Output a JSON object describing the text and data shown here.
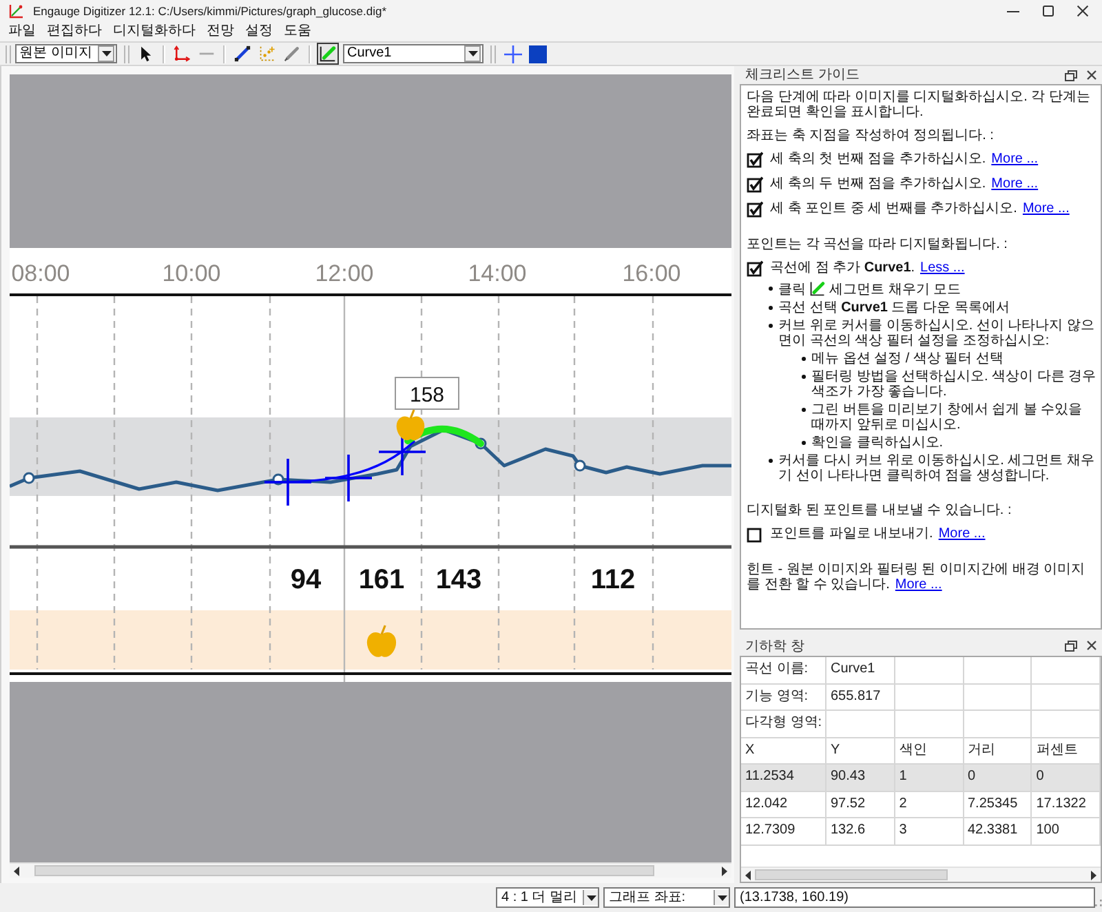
{
  "window": {
    "title": "Engauge Digitizer 12.1: C:/Users/kimmi/Pictures/graph_glucose.dig*"
  },
  "menu": [
    "파일",
    "편집하다",
    "디지털화하다",
    "전망",
    "설정",
    "도움"
  ],
  "toolbar": {
    "background": "원본 이미지",
    "tools": [
      {
        "kind": "pointer",
        "selected": false
      },
      {
        "kind": "axis",
        "selected": false
      },
      {
        "kind": "scale",
        "selected": false
      },
      {
        "kind": "curve",
        "selected": false
      },
      {
        "kind": "match",
        "selected": false
      },
      {
        "kind": "color",
        "selected": false
      },
      {
        "kind": "segment",
        "selected": true
      }
    ],
    "curve": "Curve1",
    "view_tools": [
      {
        "kind": "crosshair"
      },
      {
        "kind": "square"
      }
    ]
  },
  "graph": {
    "x_labels": [
      "08:00",
      "10:00",
      "12:00",
      "14:00",
      "16:00"
    ],
    "tooltip": "158",
    "readings": [
      "94",
      "161",
      "143",
      "112"
    ]
  },
  "checklist": {
    "title": "체크리스트 가이드",
    "blocks": [
      {
        "kind": "paragraph",
        "text": "다음 단계에 따라 이미지를 디지털화하십시오. 각 단계는 완료되면 확인을 표시합니다."
      },
      {
        "kind": "paragraph",
        "text": "좌표는 축 지점을 작성하여 정의됩니다. :"
      },
      {
        "kind": "step",
        "checked": true,
        "text": "세 축의 첫 번째 점을 추가하십시오.",
        "link": "More ..."
      },
      {
        "kind": "step",
        "checked": true,
        "text": "세 축의 두 번째 점을 추가하십시오.",
        "link": "More ..."
      },
      {
        "kind": "step",
        "checked": true,
        "text": "세 축 포인트 중 세 번째를 추가하십시오.",
        "link": "More ..."
      },
      {
        "kind": "paragraph",
        "text": "포인트는 각 곡선을 따라 디지털화됩니다. :"
      },
      {
        "kind": "step",
        "checked": true,
        "text": "곡선에 점 추가 **Curve1**.",
        "link": "Less ...",
        "bullets": [
          {
            "kind": "icon_text",
            "text": "클릭",
            "text_after": "세그먼트 채우기 모드"
          },
          {
            "kind": "text",
            "text": "곡선 선택 **Curve1** 드롭 다운 목록에서"
          },
          {
            "kind": "text",
            "text": "커브 위로 커서를 이동하십시오. 선이 나타나지 않으면이 곡선의 색상 필터 설정을 조정하십시오:",
            "children": [
              {
                "kind": "text",
                "text": "메뉴 옵션 설정 / 색상 필터 선택"
              },
              {
                "kind": "text",
                "text": "필터링 방법을 선택하십시오. 색상이 다른 경우 색조가 가장 좋습니다."
              },
              {
                "kind": "text",
                "text": "그린 버튼을 미리보기 창에서 쉽게 볼 수있을 때까지 앞뒤로 미십시오."
              },
              {
                "kind": "text",
                "text": "확인을 클릭하십시오."
              }
            ]
          },
          {
            "kind": "text",
            "text": "커서를 다시 커브 위로 이동하십시오. 세그먼트 채우기 선이 나타나면 클릭하여 점을 생성합니다."
          }
        ]
      },
      {
        "kind": "paragraph",
        "text": "디지털화 된 포인트를 내보낼 수 있습니다. :"
      },
      {
        "kind": "step",
        "checked": false,
        "text": "포인트를 파일로 내보내기.",
        "link": "More ..."
      },
      {
        "kind": "paragraph",
        "text": "힌트 - 원본 이미지와 필터링 된 이미지간에 배경 이미지를 전환 할 수 있습니다.",
        "link": "More ..."
      }
    ]
  },
  "geometry": {
    "title": "기하학 창",
    "rows": [
      {
        "cells": [
          "곡선 이름:",
          "Curve1"
        ],
        "selected": false
      },
      {
        "cells": [
          "기능 영역:",
          "655.817"
        ],
        "selected": false
      },
      {
        "cells": [
          "다각형 영역:"
        ],
        "selected": false
      },
      {
        "cells": [
          "X",
          "Y",
          "색인",
          "거리",
          "퍼센트"
        ],
        "selected": false
      },
      {
        "cells": [
          "11.2534",
          "90.43",
          "1",
          "0",
          "0"
        ],
        "selected": true
      },
      {
        "cells": [
          "12.042",
          "97.52",
          "2",
          "7.25345",
          "17.1322"
        ],
        "selected": false
      },
      {
        "cells": [
          "12.7309",
          "132.6",
          "3",
          "42.3381",
          "100"
        ],
        "selected": false
      }
    ]
  },
  "status_bar": {
    "zoom": "4 : 1 더 멀리",
    "coords_mode": "그래프 좌표:",
    "coords": "(13.1738, 160.19)"
  }
}
